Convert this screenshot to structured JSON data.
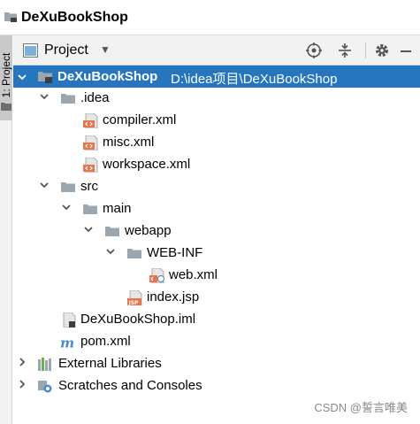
{
  "window": {
    "title": "DeXuBookShop"
  },
  "side_tab": {
    "label": "1: Project"
  },
  "toolbar": {
    "view_label": "Project"
  },
  "tree": [
    {
      "label": "DeXuBookShop",
      "path": "D:\\idea项目\\DeXuBookShop",
      "icon": "project-module-icon",
      "expanded": true
    },
    {
      "label": ".idea",
      "icon": "folder-icon",
      "expanded": true
    },
    {
      "label": "compiler.xml",
      "icon": "xml-file-icon"
    },
    {
      "label": "misc.xml",
      "icon": "xml-file-icon"
    },
    {
      "label": "workspace.xml",
      "icon": "xml-file-icon"
    },
    {
      "label": "src",
      "icon": "folder-icon",
      "expanded": true
    },
    {
      "label": "main",
      "icon": "folder-icon",
      "expanded": true
    },
    {
      "label": "webapp",
      "icon": "web-folder-icon",
      "expanded": true
    },
    {
      "label": "WEB-INF",
      "icon": "folder-icon",
      "expanded": true
    },
    {
      "label": "web.xml",
      "icon": "web-xml-file-icon"
    },
    {
      "label": "index.jsp",
      "icon": "jsp-file-icon"
    },
    {
      "label": "DeXuBookShop.iml",
      "icon": "iml-file-icon"
    },
    {
      "label": "pom.xml",
      "icon": "maven-icon"
    },
    {
      "label": "External Libraries",
      "icon": "libraries-icon",
      "expanded": false
    },
    {
      "label": "Scratches and Consoles",
      "icon": "scratches-icon",
      "expanded": false
    }
  ],
  "watermark": "CSDN @誓言唯美",
  "colors": {
    "selection": "#2675bf",
    "folder": "#9aa7b0",
    "xml": "#e8744f"
  }
}
